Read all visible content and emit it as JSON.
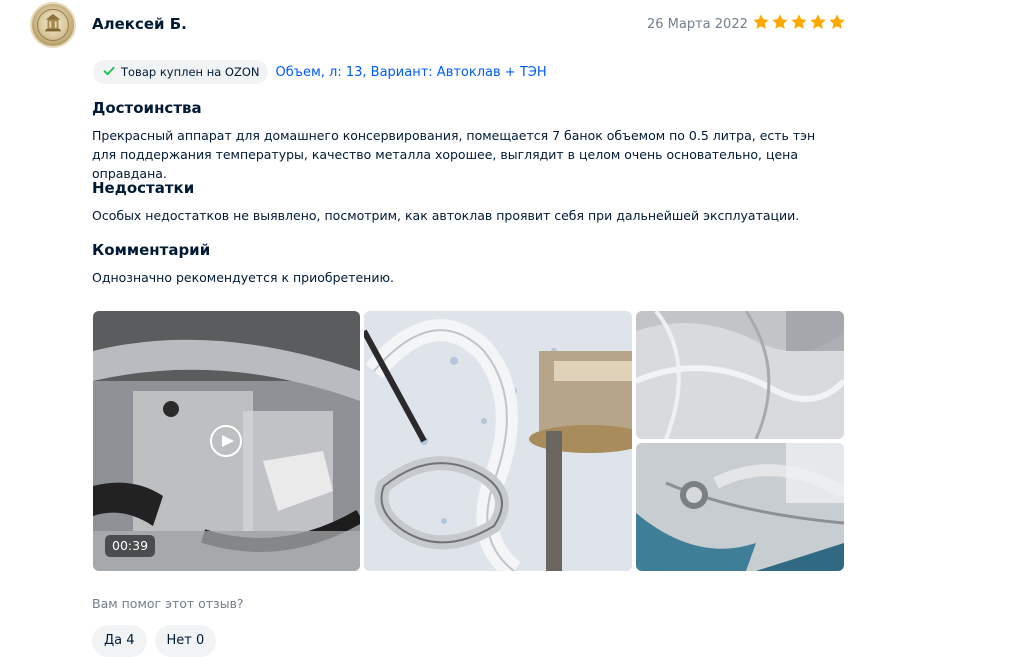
{
  "review": {
    "author": "Алексей Б.",
    "date": "26 Марта 2022",
    "rating": 5,
    "rating_max": 5,
    "purchase_badge": "Товар куплен на OZON",
    "variant": "Объем, л: 13, Вариант: Автоклав + ТЭН",
    "sections": [
      {
        "title": "Достоинства",
        "text": "Прекрасный аппарат для домашнего консервирования, помещается 7 банок объемом по 0.5 литра, есть тэн для поддержания температуры, качество металла хорошее, выглядит в целом очень основательно, цена оправдана."
      },
      {
        "title": "Недостатки",
        "text": "Особых недостатков не выявлено, посмотрим, как автоклав проявит себя при дальнейшей эксплуатации."
      },
      {
        "title": "Комментарий",
        "text": "Однозначно рекомендуется к приобретению."
      }
    ],
    "media": {
      "video_duration": "00:39"
    },
    "helpful_question": "Вам помог этот отзыв?",
    "vote_yes": "Да 4",
    "vote_no": "Нет 0"
  },
  "colors": {
    "star": "#ffa800",
    "link": "#005bff",
    "badge_check": "#10c44c",
    "muted": "#707f8d",
    "text": "#001a34",
    "chip_bg": "#f2f3f5"
  },
  "icons": [
    "avatar",
    "star-icon",
    "check-icon",
    "play-icon"
  ]
}
